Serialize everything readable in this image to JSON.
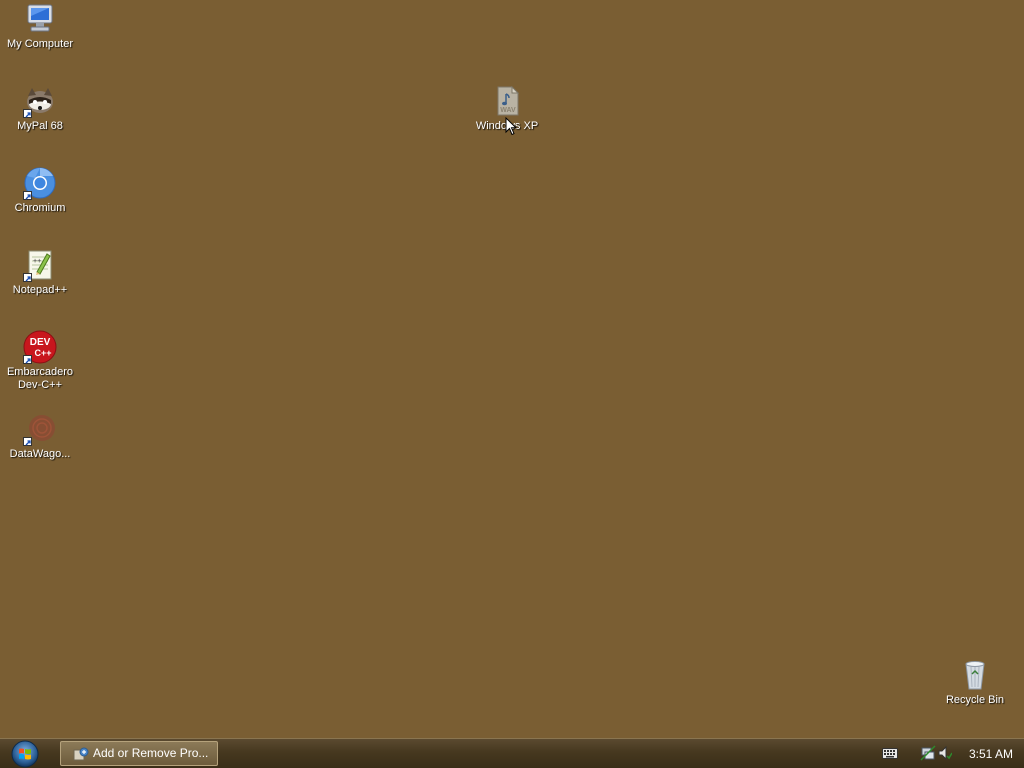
{
  "desktop": {
    "background_color": "#7a5e33",
    "icons": [
      {
        "label": "My Computer",
        "icon": "my-computer-icon"
      },
      {
        "label": "MyPal 68",
        "icon": "mypal-icon"
      },
      {
        "label": "Chromium",
        "icon": "chromium-icon"
      },
      {
        "label": "Notepad++",
        "icon": "notepadpp-icon"
      },
      {
        "label": "Embarcadero Dev-C++",
        "icon": "devcpp-icon"
      },
      {
        "label": "DataWago...",
        "icon": "datawagon-icon"
      },
      {
        "label": "Windows XP",
        "icon": "wav-file-icon"
      },
      {
        "label": "Recycle Bin",
        "icon": "recycle-bin-icon"
      }
    ],
    "devcpp_icon_text_top": "DEV",
    "devcpp_icon_text_bottom": "C++",
    "wav_icon_text": "WAV"
  },
  "taskbar": {
    "start_icon": "windows-start-orb-icon",
    "task_button_label": "Add or Remove Pro...",
    "task_button_icon": "add-remove-programs-icon",
    "tray": {
      "keyboard_icon": "keyboard-icon",
      "network_icon": "network-icon",
      "volume_icon": "volume-icon",
      "clock": "3:51 AM"
    }
  }
}
